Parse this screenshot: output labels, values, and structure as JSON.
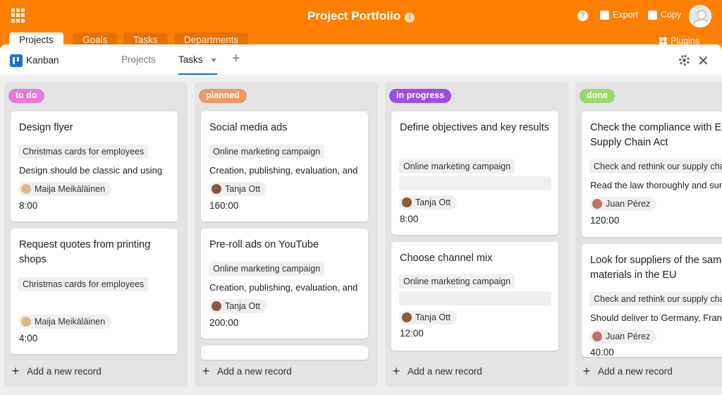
{
  "header": {
    "title": "Project Portfolio",
    "export_label": "Export",
    "copy_label": "Copy",
    "plugins_label": "Plugins",
    "tabs": [
      {
        "label": "Projects"
      },
      {
        "label": "Goals"
      },
      {
        "label": "Tasks"
      },
      {
        "label": "Departments"
      }
    ]
  },
  "toolbar": {
    "plugin_name": "Kanban",
    "views": [
      {
        "label": "Projects"
      },
      {
        "label": "Tasks"
      }
    ],
    "add_view": "+"
  },
  "add_record_label": "Add a new record",
  "columns": [
    {
      "label": "to do",
      "color": "#e87bd4",
      "cards": [
        {
          "title": "Design flyer",
          "tag": "Christmas cards for employees",
          "desc": "Design should be classic and using",
          "person": "Maija Meikäläinen",
          "time": "8:00"
        },
        {
          "title": "Request quotes from printing shops",
          "tag": "Christmas cards for employees",
          "person": "Maija Meikäläinen",
          "time": "4:00"
        }
      ]
    },
    {
      "label": "planned",
      "color": "#ed9a66",
      "cards": [
        {
          "title": "Social media ads",
          "tag": "Online marketing campaign",
          "desc": "Creation, publishing, evaluation, and",
          "person": "Tanja Ott",
          "time": "160:00"
        },
        {
          "title": "Pre-roll ads on YouTube",
          "tag": "Online marketing campaign",
          "desc": "Creation, publishing, evaluation, and",
          "person": "Tanja Ott",
          "time": "200:00"
        }
      ]
    },
    {
      "label": "in progress",
      "color": "#9b4fe0",
      "cards": [
        {
          "title": "Define objectives and key results",
          "tag": "Online marketing campaign",
          "person": "Tanja Ott",
          "time": "8:00"
        },
        {
          "title": "Choose channel mix",
          "tag": "Online marketing campaign",
          "person": "Tanja Ott",
          "time": "12:00"
        }
      ]
    },
    {
      "label": "done",
      "color": "#9bd86e",
      "cards": [
        {
          "title": "Check the compliance with EU Supply Chain Act",
          "tag": "Check and rethink our supply chain",
          "desc": "Read the law thoroughly and sum up",
          "person": "Juan Pérez",
          "time": "120:00"
        },
        {
          "title": "Look for suppliers of the same materials in the EU",
          "tag": "Check and rethink our supply chain",
          "desc": "Should deliver to Germany, France",
          "person": "Juan Pérez",
          "time": "40:00"
        }
      ]
    }
  ]
}
